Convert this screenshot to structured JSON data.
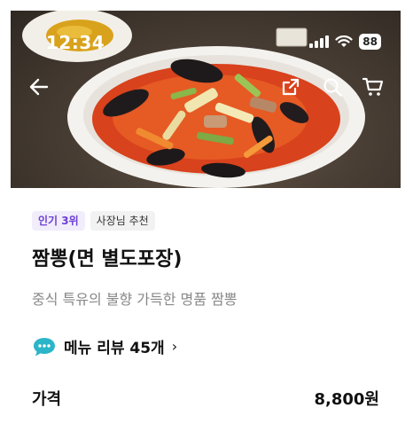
{
  "status_bar": {
    "time": "12:34",
    "battery": "88"
  },
  "hero": {
    "image_desc_icon": "food-photo-icon"
  },
  "nav": {
    "back_icon": "back-arrow-icon",
    "share_icon": "share-icon",
    "search_icon": "search-icon",
    "cart_icon": "cart-icon"
  },
  "menu": {
    "badges": [
      "인기 3위",
      "사장님 추천"
    ],
    "title": "짬뽕(면 별도포장)",
    "description": "중식 특유의 불향 가득한 명품 짬뽕",
    "review_label": "메뉴 리뷰 45개",
    "price_label": "가격",
    "price_value": "8,800원"
  },
  "colors": {
    "accent": "#6c3fd6",
    "badge_rank_bg": "#f1edfb",
    "review_bubble": "#2bb5c9"
  }
}
